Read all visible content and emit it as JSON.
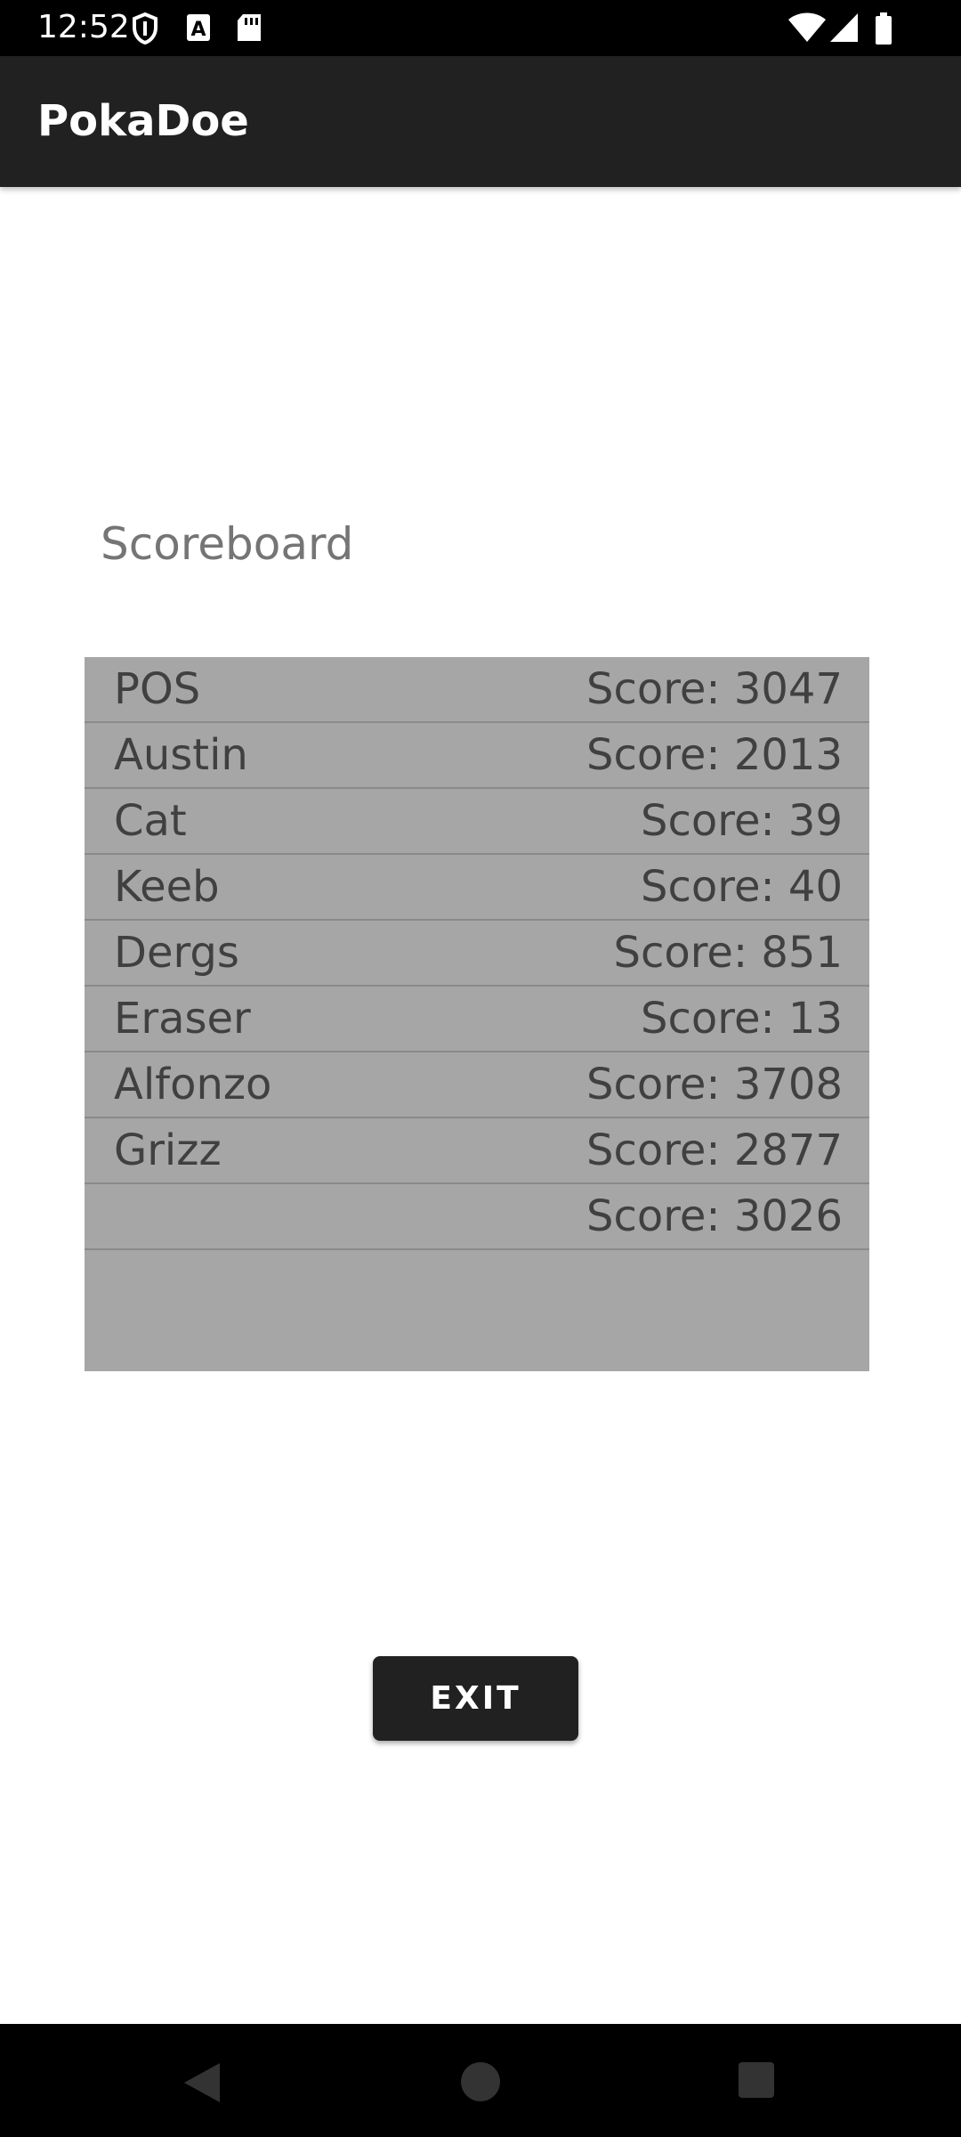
{
  "status_bar": {
    "time": "12:52",
    "icons_left": [
      "shield-icon",
      "a-box-icon",
      "sd-card-icon"
    ],
    "icons_right": [
      "wifi-icon",
      "cell-signal-icon",
      "battery-icon"
    ]
  },
  "app_bar": {
    "title": "PokaDoe"
  },
  "scoreboard": {
    "label": "Scoreboard",
    "rows": [
      {
        "name": "POS",
        "score": "Score: 3047"
      },
      {
        "name": "Austin",
        "score": "Score: 2013"
      },
      {
        "name": "Cat",
        "score": "Score: 39"
      },
      {
        "name": "Keeb",
        "score": "Score: 40"
      },
      {
        "name": "Dergs",
        "score": "Score: 851"
      },
      {
        "name": "Eraser",
        "score": "Score: 13"
      },
      {
        "name": "Alfonzo",
        "score": "Score: 3708"
      },
      {
        "name": "Grizz",
        "score": "Score: 2877"
      },
      {
        "name": "",
        "score": "Score: 3026"
      }
    ]
  },
  "exit_button": {
    "label": "EXIT"
  },
  "nav_bar": {
    "buttons": [
      "back-icon",
      "home-icon",
      "recents-icon"
    ]
  },
  "colors": {
    "app_bar": "#212121",
    "scoreboard_bg": "#a6a6a6",
    "button_bg": "#212121"
  }
}
